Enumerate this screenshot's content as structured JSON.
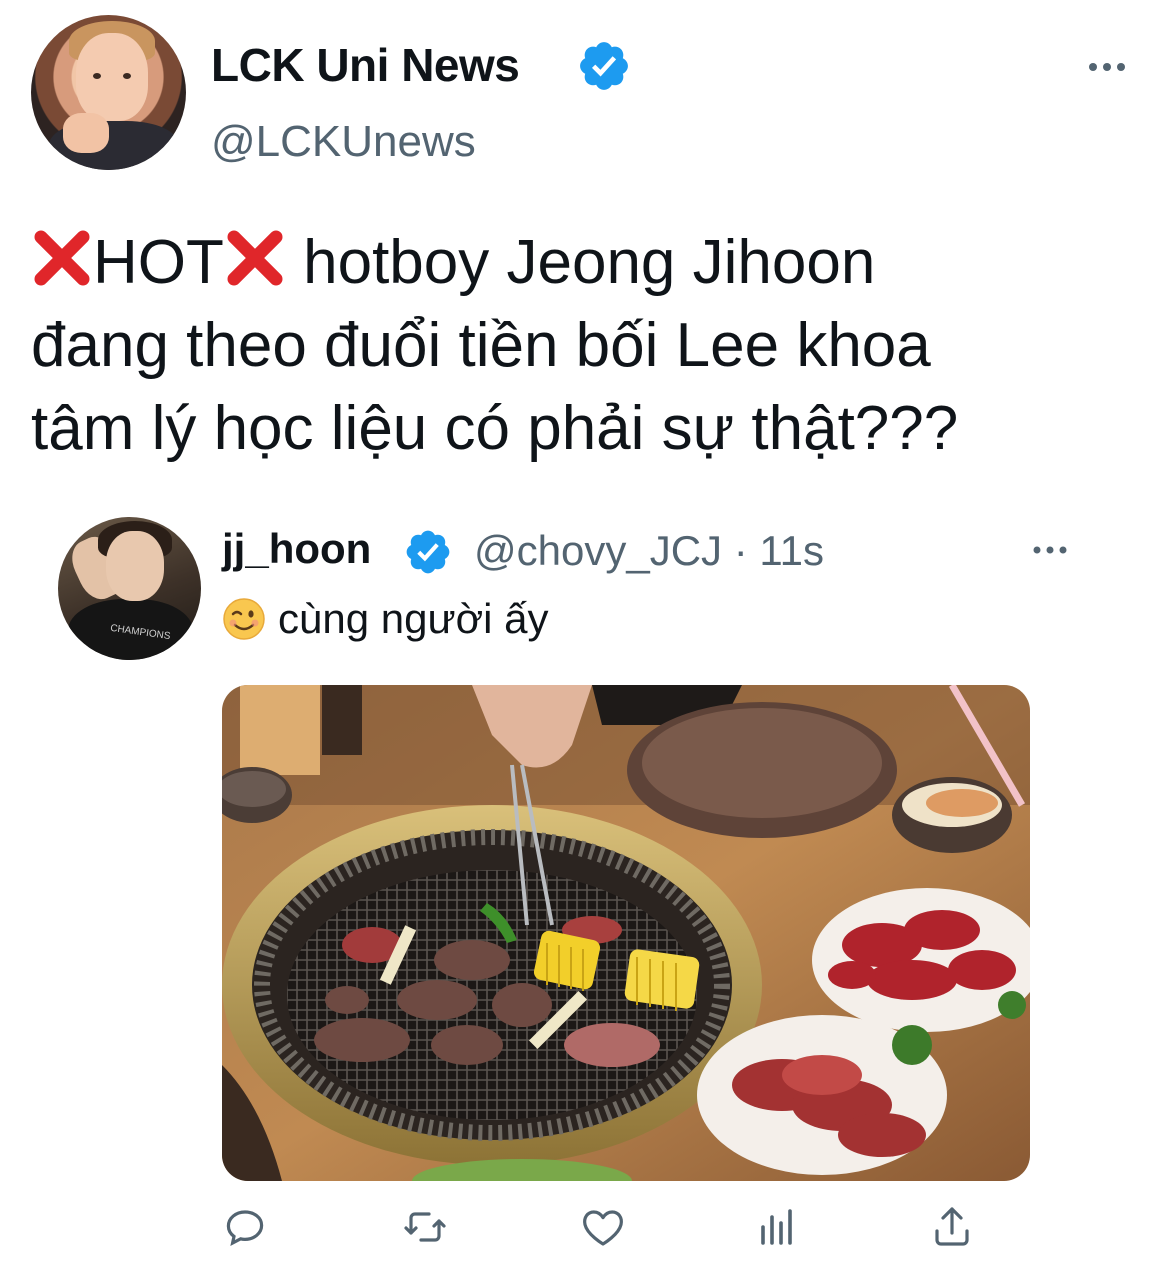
{
  "tweet": {
    "author": {
      "display_name": "LCK Uni News",
      "handle": "@LCKUnews",
      "verified": true
    },
    "text": {
      "prefix_marker": "❌",
      "hot": "HOT",
      "suffix_marker": "❌",
      "line1_rest": " hotboy Jeong Jihoon",
      "line2": "đang theo đuổi tiền bối Lee khoa",
      "line3": "tâm lý học liệu có phải sự thật???"
    },
    "more_icon": "more-horizontal-icon"
  },
  "quoted_tweet": {
    "author": {
      "display_name": "jj_hoon",
      "handle": "@chovy_JCJ",
      "separator": " · ",
      "time": "11s",
      "verified": true
    },
    "emoji": "😉",
    "text": "cùng người ấy",
    "photo_alt_icon": "korean-bbq-photo"
  },
  "actions": [
    {
      "name": "reply",
      "icon": "reply-icon"
    },
    {
      "name": "retweet",
      "icon": "retweet-icon"
    },
    {
      "name": "like",
      "icon": "heart-icon"
    },
    {
      "name": "analytics",
      "icon": "analytics-icon"
    },
    {
      "name": "share",
      "icon": "share-icon"
    }
  ],
  "colors": {
    "text_primary": "#0f1419",
    "text_secondary": "#536471",
    "verified_blue": "#1d9bf0",
    "icon_gray": "#536471",
    "x_mark_red": "#e0262a"
  }
}
